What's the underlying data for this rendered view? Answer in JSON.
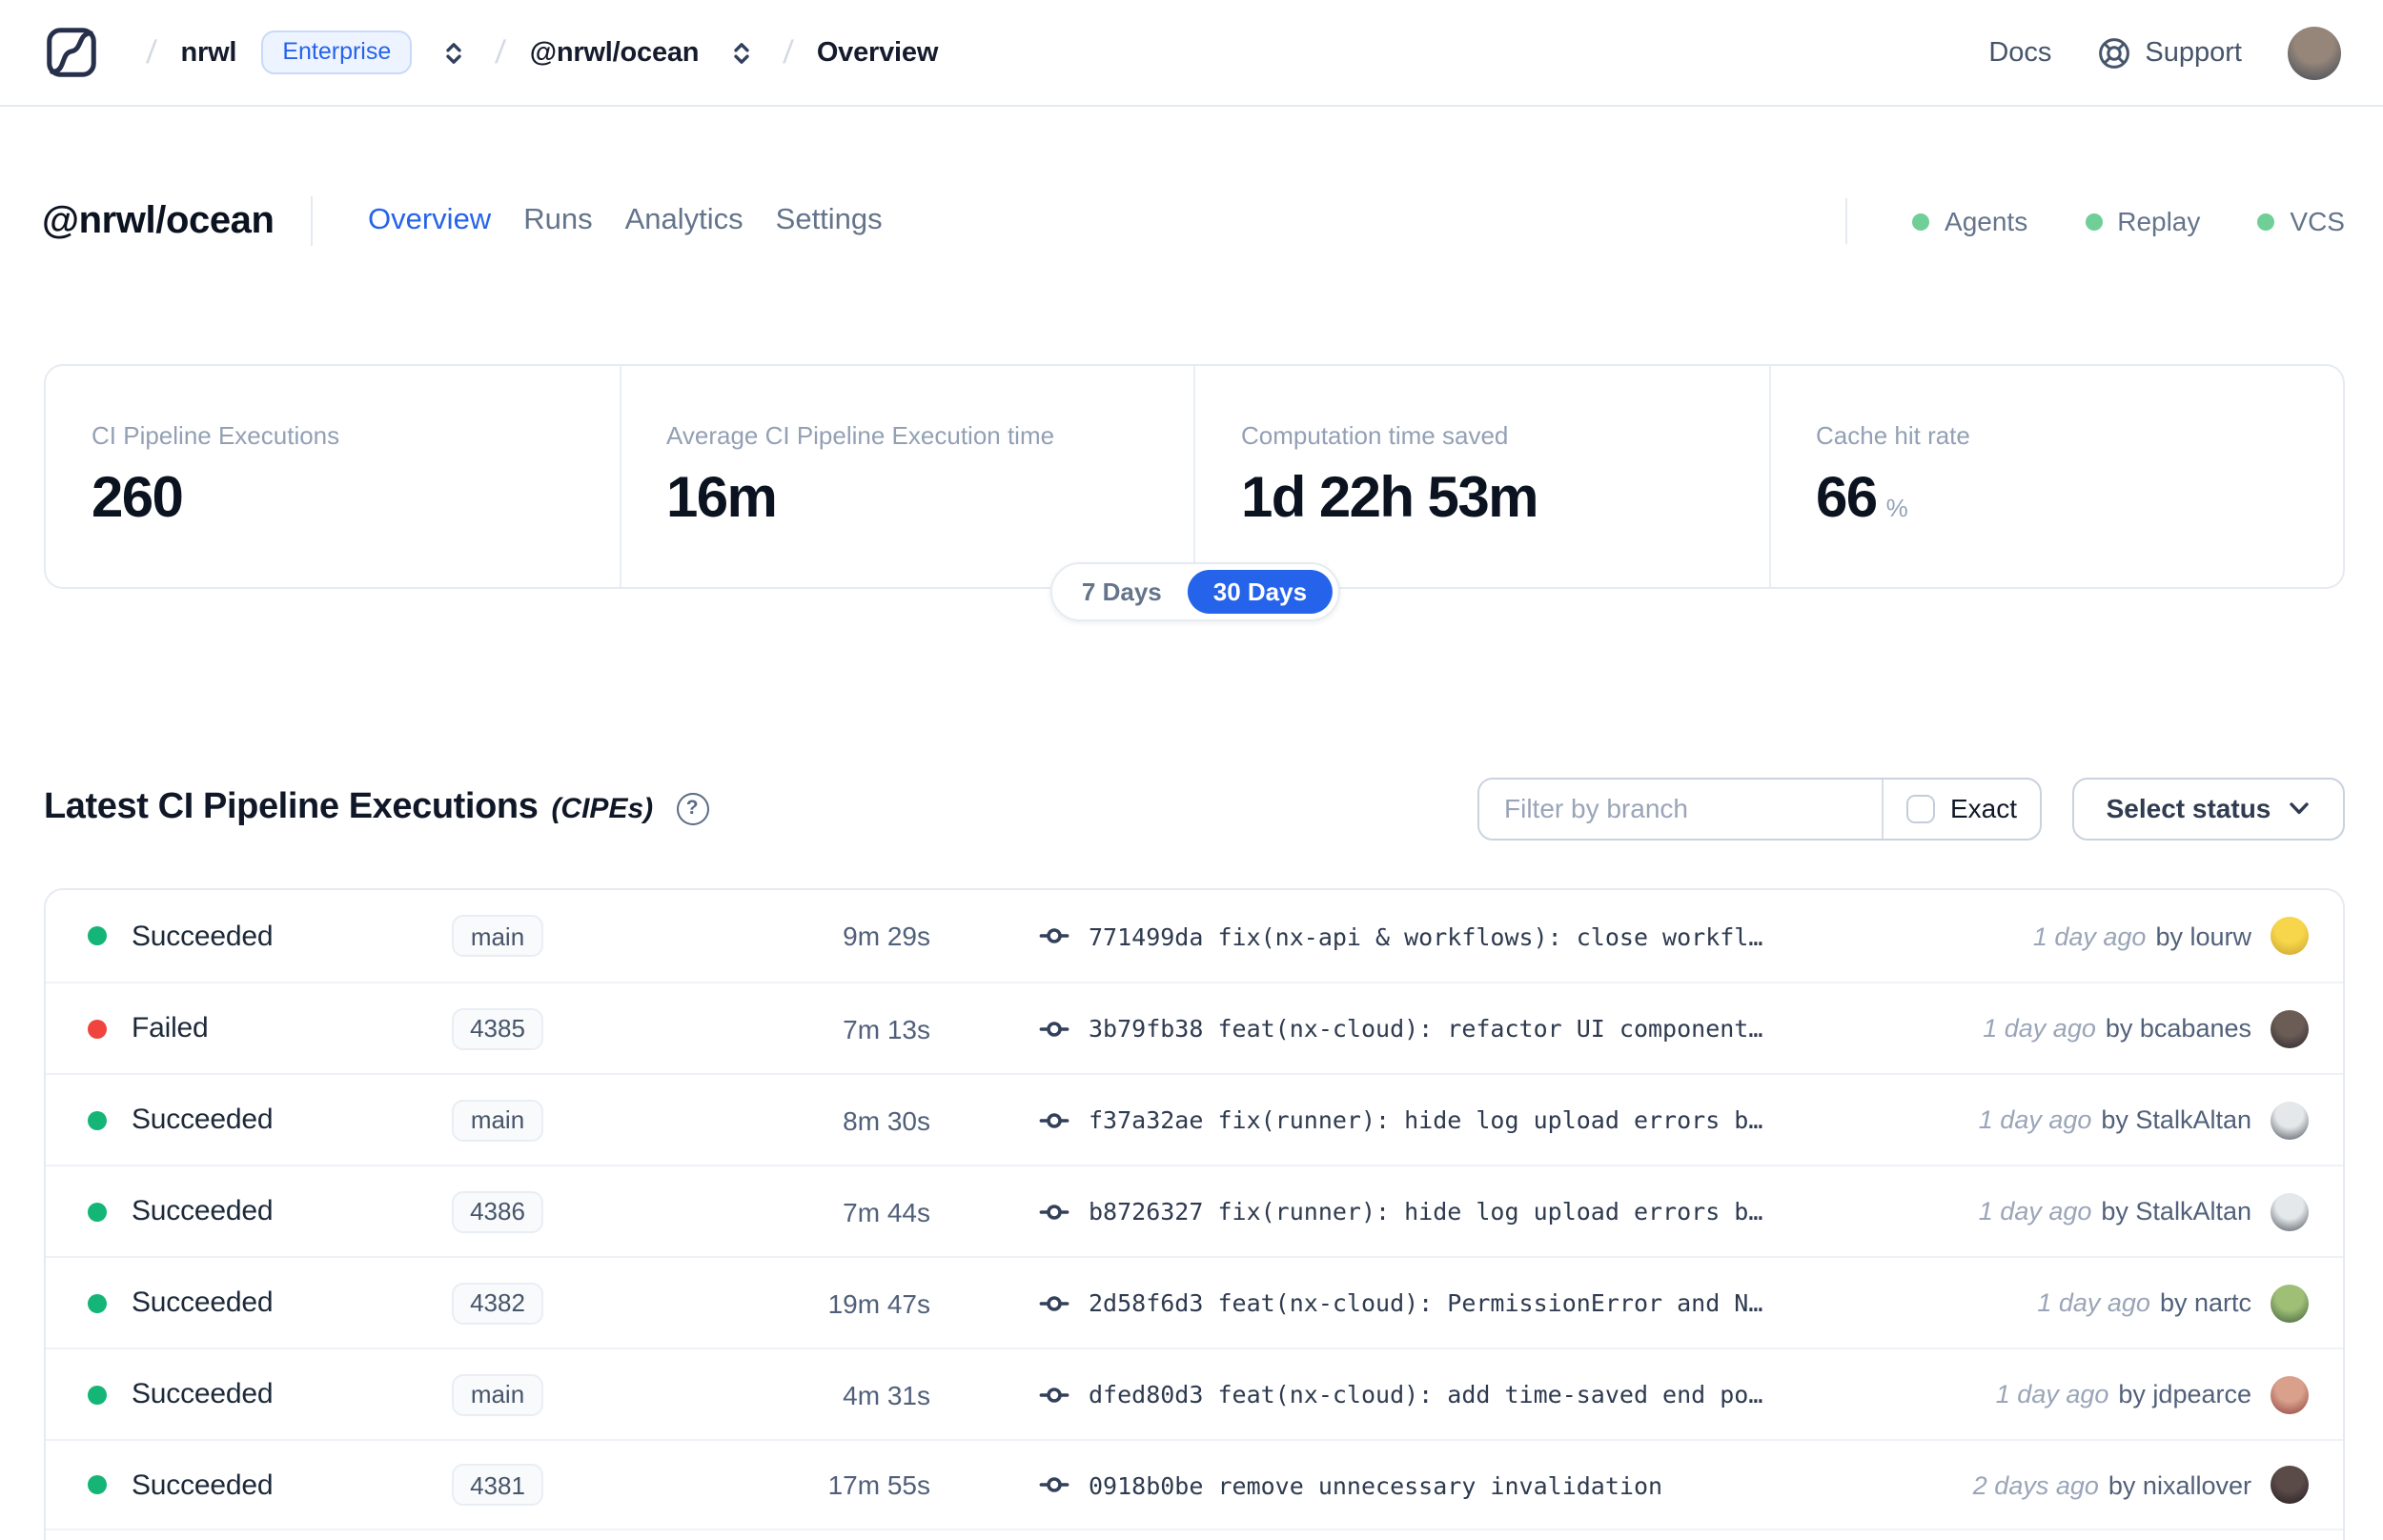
{
  "header": {
    "breadcrumb": {
      "separator": "/",
      "org": "nrwl",
      "org_badge": "Enterprise",
      "workspace": "@nrwl/ocean",
      "page": "Overview"
    },
    "nav": {
      "docs": "Docs",
      "support": "Support"
    },
    "avatar_colors": [
      "#96867a",
      "#3c4654"
    ]
  },
  "workspace": {
    "title": "@nrwl/ocean",
    "tabs": [
      {
        "label": "Overview",
        "active": true
      },
      {
        "label": "Runs",
        "active": false
      },
      {
        "label": "Analytics",
        "active": false
      },
      {
        "label": "Settings",
        "active": false
      }
    ],
    "features": [
      {
        "label": "Agents"
      },
      {
        "label": "Replay"
      },
      {
        "label": "VCS"
      }
    ],
    "feature_dot_color": "#6fcf97"
  },
  "stats": {
    "cards": [
      {
        "label": "CI Pipeline Executions",
        "value": "260",
        "suffix": ""
      },
      {
        "label": "Average CI Pipeline Execution time",
        "value": "16m",
        "suffix": ""
      },
      {
        "label": "Computation time saved",
        "value": "1d 22h 53m",
        "suffix": ""
      },
      {
        "label": "Cache hit rate",
        "value": "66",
        "suffix": "%"
      }
    ]
  },
  "range_toggle": {
    "options": [
      {
        "label": "7 Days",
        "active": false
      },
      {
        "label": "30 Days",
        "active": true
      }
    ]
  },
  "cipe": {
    "title": "Latest CI Pipeline Executions",
    "subtitle": "(CIPEs)",
    "help_glyph": "?",
    "filter": {
      "placeholder": "Filter by branch",
      "exact_label": "Exact",
      "exact_checked": false
    },
    "status_select_label": "Select status"
  },
  "table": {
    "rows": [
      {
        "status": "Succeeded",
        "status_color": "#14b576",
        "branch": "main",
        "duration": "9m 29s",
        "commit_hash": "771499da",
        "commit_message": "fix(nx-api & workflows): close workfl…",
        "time_ago": "1 day ago",
        "author": "by lourw",
        "avatar_colors": [
          "#f7d64b",
          "#c9a02f"
        ]
      },
      {
        "status": "Failed",
        "status_color": "#f0443f",
        "branch": "4385",
        "duration": "7m 13s",
        "commit_hash": "3b79fb38",
        "commit_message": "feat(nx-cloud): refactor UI component…",
        "time_ago": "1 day ago",
        "author": "by bcabanes",
        "avatar_colors": [
          "#6b5d55",
          "#2c2630"
        ]
      },
      {
        "status": "Succeeded",
        "status_color": "#14b576",
        "branch": "main",
        "duration": "8m 30s",
        "commit_hash": "f37a32ae",
        "commit_message": "fix(runner): hide log upload errors b…",
        "time_ago": "1 day ago",
        "author": "by StalkAltan",
        "avatar_colors": [
          "#e4e8ea",
          "#4a505a"
        ]
      },
      {
        "status": "Succeeded",
        "status_color": "#14b576",
        "branch": "4386",
        "duration": "7m 44s",
        "commit_hash": "b8726327",
        "commit_message": "fix(runner): hide log upload errors b…",
        "time_ago": "1 day ago",
        "author": "by StalkAltan",
        "avatar_colors": [
          "#e4e8ea",
          "#4a505a"
        ]
      },
      {
        "status": "Succeeded",
        "status_color": "#14b576",
        "branch": "4382",
        "duration": "19m 47s",
        "commit_hash": "2d58f6d3",
        "commit_message": "feat(nx-cloud): PermissionError and N…",
        "time_ago": "1 day ago",
        "author": "by nartc",
        "avatar_colors": [
          "#9fbf77",
          "#3f5c3a"
        ]
      },
      {
        "status": "Succeeded",
        "status_color": "#14b576",
        "branch": "main",
        "duration": "4m 31s",
        "commit_hash": "dfed80d3",
        "commit_message": "feat(nx-cloud): add time-saved end po…",
        "time_ago": "1 day ago",
        "author": "by jdpearce",
        "avatar_colors": [
          "#d9a08c",
          "#8c3f3d"
        ]
      },
      {
        "status": "Succeeded",
        "status_color": "#14b576",
        "branch": "4381",
        "duration": "17m 55s",
        "commit_hash": "0918b0be",
        "commit_message": "remove unnecessary invalidation",
        "time_ago": "2 days ago",
        "author": "by nixallover",
        "avatar_colors": [
          "#5a4a48",
          "#241d20"
        ]
      }
    ]
  },
  "icons": {
    "logo": "nx-cloud-logo",
    "breadcrumb_selector": "chevrons-up-down-icon",
    "support": "lifebuoy-icon",
    "help": "question-circle-icon",
    "commit": "git-commit-icon",
    "select_chevron": "chevron-down-icon",
    "status_dot": "status-dot-icon"
  },
  "colors": {
    "accent_blue": "#2563eb",
    "success_green": "#14b576",
    "failed_red": "#f0443f",
    "soft_green_dot": "#6fcf97",
    "border": "#e6ebf1"
  }
}
